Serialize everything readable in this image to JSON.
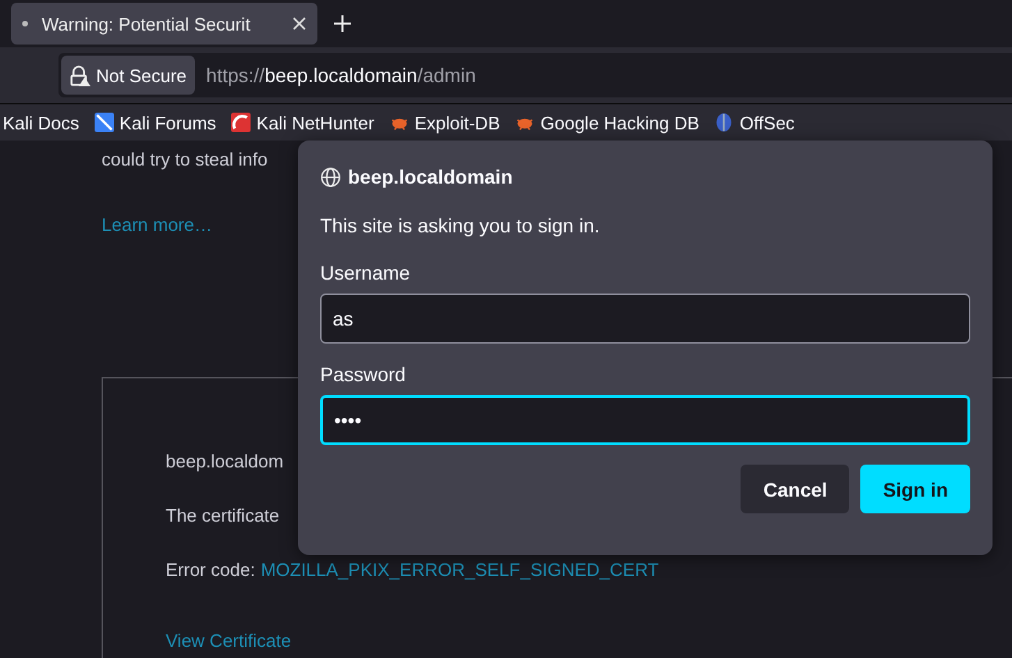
{
  "tabs": [
    {
      "title": "Warning: Potential Securit",
      "selected": true
    }
  ],
  "url_bar": {
    "badge": "Not Secure",
    "prefix": "https://",
    "host": "beep.localdomain",
    "path": "/admin"
  },
  "bookmarks": [
    {
      "label": "Kali Docs",
      "kind": "none"
    },
    {
      "label": "Kali Forums",
      "kind": "dragon"
    },
    {
      "label": "Kali NetHunter",
      "kind": "nethunter"
    },
    {
      "label": "Exploit-DB",
      "kind": "bug"
    },
    {
      "label": "Google Hacking DB",
      "kind": "bug"
    },
    {
      "label": "OffSec",
      "kind": "offsec"
    }
  ],
  "page": {
    "text_top": "could try to steal info",
    "learn_more": "Learn more…",
    "box_lines": [
      {
        "kind": "text",
        "text": "beep.localdom"
      },
      {
        "kind": "text",
        "text": "The certificate"
      },
      {
        "kind": "code",
        "label": "Error code:",
        "code": "MOZILLA_PKIX_ERROR_SELF_SIGNED_CERT"
      },
      {
        "kind": "link",
        "text": "View Certificate"
      }
    ]
  },
  "dialog": {
    "host": "beep.localdomain",
    "message": "This site is asking you to sign in.",
    "fields": [
      {
        "label": "Username",
        "value": "as",
        "focused": false
      },
      {
        "label": "Password",
        "value": "••••",
        "focused": true
      }
    ],
    "buttons": [
      {
        "label": "Cancel",
        "kind": "secondary"
      },
      {
        "label": "Sign in",
        "kind": "primary"
      }
    ]
  }
}
